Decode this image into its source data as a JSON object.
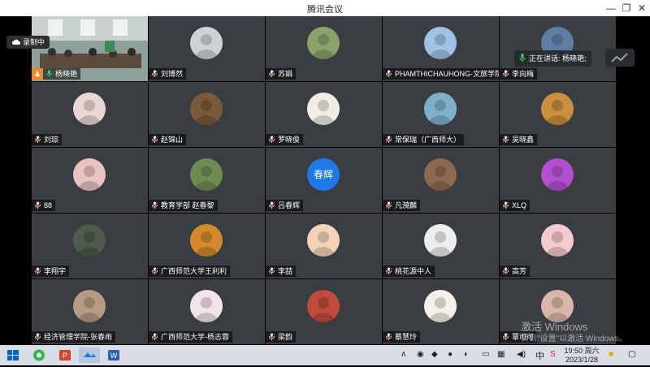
{
  "window": {
    "title": "腾讯会议",
    "min": "—",
    "max": "❐",
    "close": "✕"
  },
  "status": {
    "recording": "录制中",
    "speaking": "正在讲话: 杨晓艳;"
  },
  "participants": [
    {
      "name": "杨晓艳",
      "kind": "camera"
    },
    {
      "name": "刘博然",
      "kind": "photo",
      "fill": "#cfd2d4"
    },
    {
      "name": "苏娟",
      "kind": "photo",
      "fill": "#8aa36b"
    },
    {
      "name": "PHAMTHICHAUHONG-文旅学院",
      "kind": "photo",
      "fill": "#9fc3e6"
    },
    {
      "name": "李向梅",
      "kind": "photo",
      "fill": "#5e7ea3"
    },
    {
      "name": "刘琮",
      "kind": "photo",
      "fill": "#e9d7d5"
    },
    {
      "name": "赵锦山",
      "kind": "photo",
      "fill": "#7a5a3a"
    },
    {
      "name": "罗晓俊",
      "kind": "photo",
      "fill": "#f1ede4"
    },
    {
      "name": "常保瑞（广西师大）",
      "kind": "photo",
      "fill": "#7fb0c9"
    },
    {
      "name": "吴晓鑫",
      "kind": "photo",
      "fill": "#c98f3d"
    },
    {
      "name": "88",
      "kind": "photo",
      "fill": "#e8c3c0"
    },
    {
      "name": "教育学部  赵春黎",
      "kind": "photo",
      "fill": "#6f8b52"
    },
    {
      "name": "吕春辉",
      "kind": "text",
      "initials": "春辉"
    },
    {
      "name": "凡漪麟",
      "kind": "photo",
      "fill": "#8c6a4f"
    },
    {
      "name": "XLQ",
      "kind": "photo",
      "fill": "#b24fd0"
    },
    {
      "name": "李翔宇",
      "kind": "photo",
      "fill": "#4d5b4a"
    },
    {
      "name": "广西师范大学王利利",
      "kind": "photo",
      "fill": "#d48a2c"
    },
    {
      "name": "李喆",
      "kind": "photo",
      "fill": "#f3d3b8"
    },
    {
      "name": "桃花源中人",
      "kind": "photo",
      "fill": "#eeeeee"
    },
    {
      "name": "高芳",
      "kind": "photo",
      "fill": "#f4c9cf"
    },
    {
      "name": "经济管理学院-张春雨",
      "kind": "photo",
      "fill": "#b59b86"
    },
    {
      "name": "广西师范大学-杨志蓉",
      "kind": "photo",
      "fill": "#f2e4e7"
    },
    {
      "name": "梁韵",
      "kind": "photo",
      "fill": "#c04b3c"
    },
    {
      "name": "蔡慧玲",
      "kind": "photo",
      "fill": "#f5f0e8"
    },
    {
      "name": "覃可可",
      "kind": "photo",
      "fill": "#d9b7a8"
    }
  ],
  "watermark": {
    "line1": "激活 Windows",
    "line2": "转到\"设置\"以激活 Windows。"
  },
  "taskbar": {
    "apps": [
      "windows-start",
      "browser",
      "powerpoint",
      "tencent-meeting",
      "word"
    ],
    "tray_lang": "中",
    "clock_time": "19:50 周六",
    "clock_date": "2023/1/28"
  },
  "colors": {
    "tile": "#3a3d42",
    "accent": "#1f7ae8",
    "taskbar": "#d8dde6"
  }
}
